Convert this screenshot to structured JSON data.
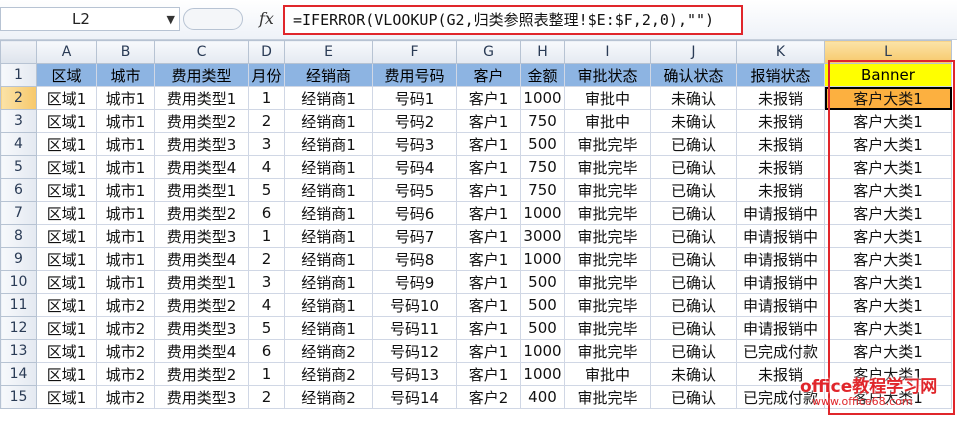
{
  "formula_bar": {
    "cell_ref": "L2",
    "fx_symbol": "fx",
    "formula": "=IFERROR(VLOOKUP(G2,归类参照表整理!$E:$F,2,0),\"\")"
  },
  "sheet": {
    "columns": [
      "A",
      "B",
      "C",
      "D",
      "E",
      "F",
      "G",
      "H",
      "I",
      "J",
      "K",
      "L"
    ],
    "selected_column": "L",
    "active_cell": "L2",
    "rows": [
      {
        "n": "1",
        "cells": [
          "区域",
          "城市",
          "费用类型",
          "月份",
          "经销商",
          "费用号码",
          "客户",
          "金额",
          "审批状态",
          "确认状态",
          "报销状态",
          "Banner"
        ]
      },
      {
        "n": "2",
        "cells": [
          "区域1",
          "城市1",
          "费用类型1",
          "1",
          "经销商1",
          "号码1",
          "客户1",
          "1000",
          "审批中",
          "未确认",
          "未报销",
          "客户大类1"
        ]
      },
      {
        "n": "3",
        "cells": [
          "区域1",
          "城市1",
          "费用类型2",
          "2",
          "经销商1",
          "号码2",
          "客户1",
          "750",
          "审批中",
          "未确认",
          "未报销",
          "客户大类1"
        ]
      },
      {
        "n": "4",
        "cells": [
          "区域1",
          "城市1",
          "费用类型3",
          "3",
          "经销商1",
          "号码3",
          "客户1",
          "500",
          "审批完毕",
          "已确认",
          "未报销",
          "客户大类1"
        ]
      },
      {
        "n": "5",
        "cells": [
          "区域1",
          "城市1",
          "费用类型4",
          "4",
          "经销商1",
          "号码4",
          "客户1",
          "750",
          "审批完毕",
          "已确认",
          "未报销",
          "客户大类1"
        ]
      },
      {
        "n": "6",
        "cells": [
          "区域1",
          "城市1",
          "费用类型1",
          "5",
          "经销商1",
          "号码5",
          "客户1",
          "750",
          "审批完毕",
          "已确认",
          "未报销",
          "客户大类1"
        ]
      },
      {
        "n": "7",
        "cells": [
          "区域1",
          "城市1",
          "费用类型2",
          "6",
          "经销商1",
          "号码6",
          "客户1",
          "1000",
          "审批完毕",
          "已确认",
          "申请报销中",
          "客户大类1"
        ]
      },
      {
        "n": "8",
        "cells": [
          "区域1",
          "城市1",
          "费用类型3",
          "1",
          "经销商1",
          "号码7",
          "客户1",
          "3000",
          "审批完毕",
          "已确认",
          "申请报销中",
          "客户大类1"
        ]
      },
      {
        "n": "9",
        "cells": [
          "区域1",
          "城市1",
          "费用类型4",
          "2",
          "经销商1",
          "号码8",
          "客户1",
          "1000",
          "审批完毕",
          "已确认",
          "申请报销中",
          "客户大类1"
        ]
      },
      {
        "n": "10",
        "cells": [
          "区域1",
          "城市1",
          "费用类型1",
          "3",
          "经销商1",
          "号码9",
          "客户1",
          "500",
          "审批完毕",
          "已确认",
          "申请报销中",
          "客户大类1"
        ]
      },
      {
        "n": "11",
        "cells": [
          "区域1",
          "城市2",
          "费用类型2",
          "4",
          "经销商1",
          "号码10",
          "客户1",
          "500",
          "审批完毕",
          "已确认",
          "申请报销中",
          "客户大类1"
        ]
      },
      {
        "n": "12",
        "cells": [
          "区域1",
          "城市2",
          "费用类型3",
          "5",
          "经销商1",
          "号码11",
          "客户1",
          "500",
          "审批完毕",
          "已确认",
          "申请报销中",
          "客户大类1"
        ]
      },
      {
        "n": "13",
        "cells": [
          "区域1",
          "城市2",
          "费用类型4",
          "6",
          "经销商2",
          "号码12",
          "客户1",
          "1000",
          "审批完毕",
          "已确认",
          "已完成付款",
          "客户大类1"
        ]
      },
      {
        "n": "14",
        "cells": [
          "区域1",
          "城市2",
          "费用类型2",
          "1",
          "经销商2",
          "号码13",
          "客户1",
          "1000",
          "审批中",
          "未确认",
          "未报销",
          "客户大类1"
        ]
      },
      {
        "n": "15",
        "cells": [
          "区域1",
          "城市2",
          "费用类型3",
          "2",
          "经销商2",
          "号码14",
          "客户2",
          "400",
          "审批完毕",
          "已确认",
          "已完成付款",
          "客户大类1"
        ]
      }
    ]
  },
  "watermark": {
    "main": "office教程学习网",
    "url": "www.office68.com"
  },
  "colors": {
    "header_row_fill": "#8db4e2",
    "banner_header_fill": "#ffff00",
    "active_cell_fill": "#fcb040",
    "highlight_border": "#e0262b"
  }
}
